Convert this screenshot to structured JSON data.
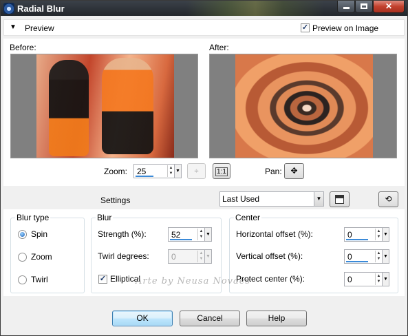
{
  "window": {
    "title": "Radial Blur"
  },
  "preview_bar": {
    "label": "Preview",
    "preview_on_image_label": "Preview on Image",
    "preview_on_image_checked": true
  },
  "preview": {
    "before_label": "Before:",
    "after_label": "After:",
    "zoom_label": "Zoom:",
    "zoom_value": "25",
    "one_to_one_label": "1:1",
    "pan_label": "Pan:"
  },
  "settings": {
    "label": "Settings",
    "preset_value": "Last Used"
  },
  "blur_type": {
    "title": "Blur type",
    "options": [
      {
        "label": "Spin",
        "selected": true
      },
      {
        "label": "Zoom",
        "selected": false
      },
      {
        "label": "Twirl",
        "selected": false
      }
    ]
  },
  "blur": {
    "title": "Blur",
    "strength_label": "Strength (%):",
    "strength_value": "52",
    "twirl_label": "Twirl degrees:",
    "twirl_value": "0",
    "elliptical_label": "Elliptical",
    "elliptical_checked": true
  },
  "center": {
    "title": "Center",
    "h_offset_label": "Horizontal offset (%):",
    "h_offset_value": "0",
    "v_offset_label": "Vertical offset (%):",
    "v_offset_value": "0",
    "protect_label": "Protect center (%):",
    "protect_value": "0"
  },
  "buttons": {
    "ok": "OK",
    "cancel": "Cancel",
    "help": "Help"
  },
  "watermark": "Arte by Neusa Novaes"
}
